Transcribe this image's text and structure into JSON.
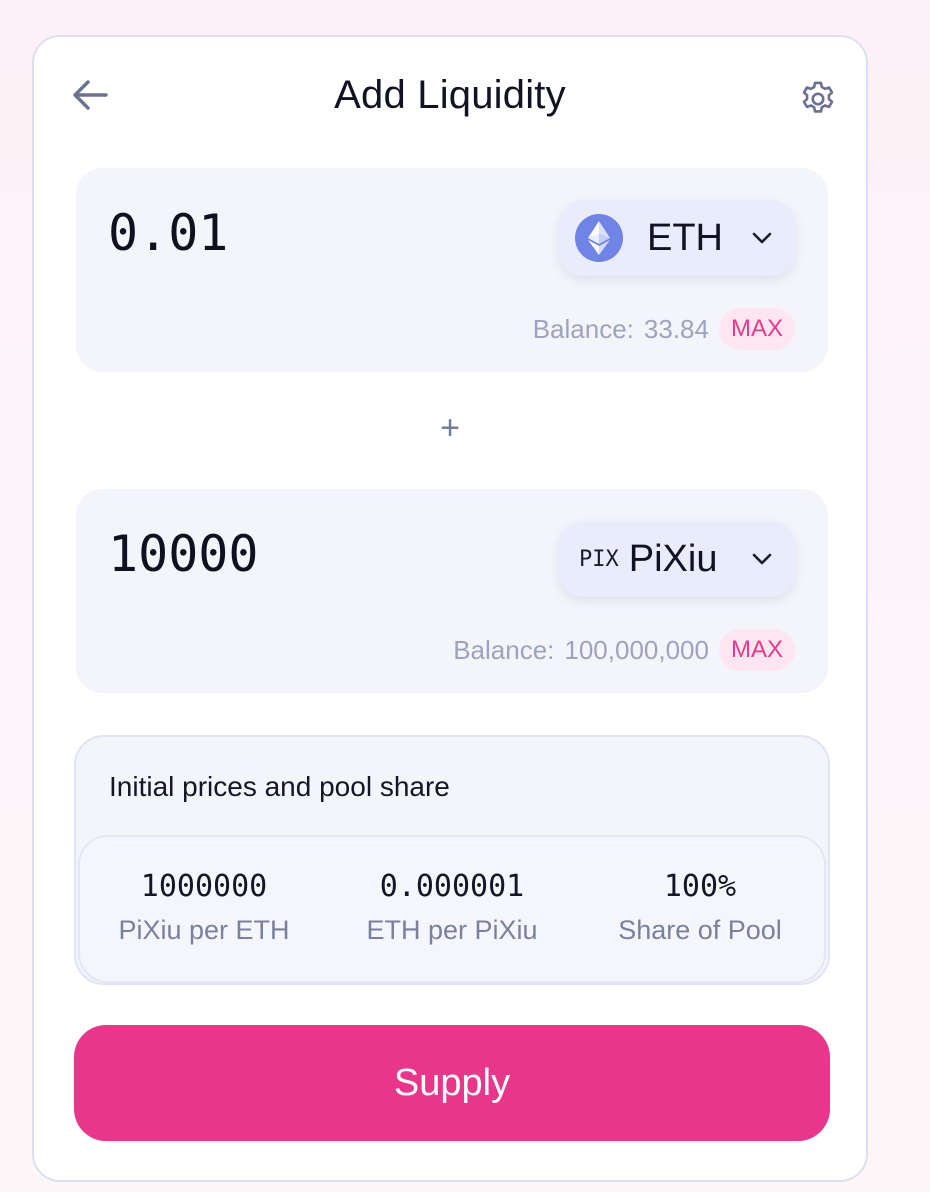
{
  "header": {
    "title": "Add Liquidity",
    "back_icon": "arrow-left-icon",
    "settings_icon": "gear-icon"
  },
  "token_a": {
    "amount": "0.01",
    "symbol": "ETH",
    "logo_icon": "ethereum-icon",
    "balance_label": "Balance:",
    "balance_value": "33.84",
    "max_label": "MAX"
  },
  "separator": "+",
  "token_b": {
    "amount": "10000",
    "logo_text": "PIX",
    "symbol": "PiXiu",
    "balance_label": "Balance:",
    "balance_value": "100,000,000",
    "max_label": "MAX"
  },
  "prices": {
    "title": "Initial prices and pool share",
    "stats": [
      {
        "value": "1000000",
        "label": "PiXiu per ETH"
      },
      {
        "value": "0.000001",
        "label": "ETH per PiXiu"
      },
      {
        "value": "100%",
        "label": "Share of Pool"
      }
    ]
  },
  "actions": {
    "supply_label": "Supply"
  },
  "colors": {
    "accent": "#e8378a",
    "max_bg": "#fde6ef",
    "panel_bg": "#f4f5fb",
    "selector_bg": "#e8ecfb",
    "eth_logo": "#6f84e4"
  }
}
